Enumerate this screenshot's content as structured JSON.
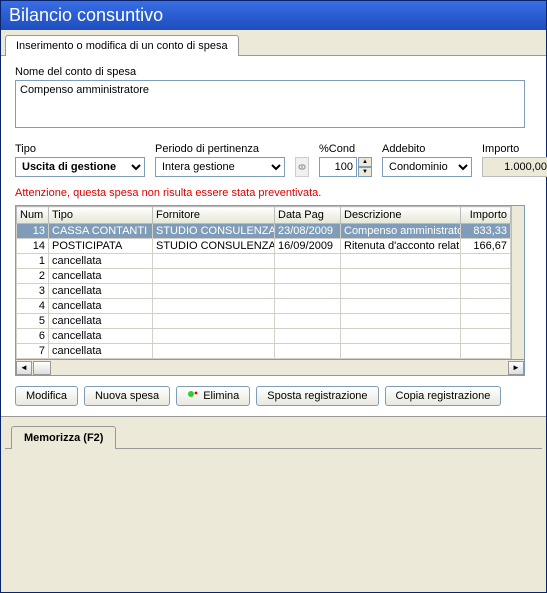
{
  "window": {
    "title": "Bilancio consuntivo"
  },
  "tab": {
    "label": "Inserimento o modifica di un conto di spesa"
  },
  "name": {
    "label": "Nome del conto di spesa",
    "value": "Compenso amministratore"
  },
  "tipo": {
    "label": "Tipo",
    "value": "Uscita di gestione"
  },
  "periodo": {
    "label": "Periodo di pertinenza",
    "value": "Intera gestione"
  },
  "cond": {
    "label": "%Cond",
    "value": "100"
  },
  "addebito": {
    "label": "Addebito",
    "value": "Condominio"
  },
  "importo": {
    "label": "Importo",
    "value": "1.000,00"
  },
  "warning": "Attenzione, questa spesa non risulta essere stata preventivata.",
  "grid": {
    "headers": {
      "num": "Num",
      "tipo": "Tipo",
      "fornitore": "Fornitore",
      "data": "Data Pag",
      "descr": "Descrizione",
      "importo": "Importo"
    },
    "rows": [
      {
        "num": "13",
        "tipo": "CASSA CONTANTI",
        "fornitore": "STUDIO CONSULENZA",
        "data": "23/08/2009",
        "descr": "Compenso amministratore",
        "importo": "833,33",
        "sel": true
      },
      {
        "num": "14",
        "tipo": "POSTICIPATA",
        "fornitore": "STUDIO CONSULENZA",
        "data": "16/09/2009",
        "descr": "Ritenuta d'acconto relat",
        "importo": "166,67",
        "sel": false
      },
      {
        "num": "1",
        "tipo": "cancellata",
        "fornitore": "",
        "data": "",
        "descr": "",
        "importo": "",
        "sel": false
      },
      {
        "num": "2",
        "tipo": "cancellata",
        "fornitore": "",
        "data": "",
        "descr": "",
        "importo": "",
        "sel": false
      },
      {
        "num": "3",
        "tipo": "cancellata",
        "fornitore": "",
        "data": "",
        "descr": "",
        "importo": "",
        "sel": false
      },
      {
        "num": "4",
        "tipo": "cancellata",
        "fornitore": "",
        "data": "",
        "descr": "",
        "importo": "",
        "sel": false
      },
      {
        "num": "5",
        "tipo": "cancellata",
        "fornitore": "",
        "data": "",
        "descr": "",
        "importo": "",
        "sel": false
      },
      {
        "num": "6",
        "tipo": "cancellata",
        "fornitore": "",
        "data": "",
        "descr": "",
        "importo": "",
        "sel": false
      },
      {
        "num": "7",
        "tipo": "cancellata",
        "fornitore": "",
        "data": "",
        "descr": "",
        "importo": "",
        "sel": false
      }
    ]
  },
  "buttons": {
    "modifica": "Modifica",
    "nuova": "Nuova spesa",
    "elimina": "Elimina",
    "sposta": "Sposta registrazione",
    "copia": "Copia registrazione"
  },
  "lower": {
    "memorizza": "Memorizza (F2)"
  }
}
